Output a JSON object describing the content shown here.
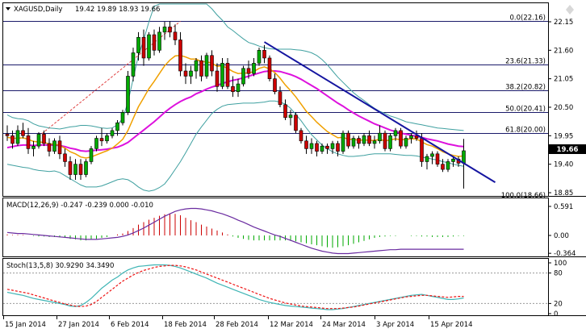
{
  "header": {
    "symbol": "XAGUSD,Daily",
    "ohlc": "19.42 19.89 18.93 19.66"
  },
  "main_panel": {
    "price_axis": [
      "22.15",
      "21.60",
      "21.05",
      "20.50",
      "19.95",
      "19.40",
      "18.85"
    ],
    "current_price": "19.66",
    "fib_levels": [
      {
        "label": "0.0(22.16)",
        "value": 22.16
      },
      {
        "label": "23.6(21.33)",
        "value": 21.33
      },
      {
        "label": "38.2(20.82)",
        "value": 20.82
      },
      {
        "label": "50.0(20.41)",
        "value": 20.41
      },
      {
        "label": "61.8(20.00)",
        "value": 20.0
      },
      {
        "label": "100.0(18.66)",
        "value": 18.66
      }
    ]
  },
  "macd_panel": {
    "title": "MACD(12,26,9) -0.247 -0.239 0.000 -0.010",
    "axis": [
      "0.591",
      "0.00",
      "-0.364"
    ]
  },
  "stoch_panel": {
    "title": "Stoch(13,5,8) 30.9290 34.3490",
    "axis": [
      "100",
      "80",
      "20",
      "0"
    ]
  },
  "time_axis": [
    "15 Jan 2014",
    "27 Jan 2014",
    "6 Feb 2014",
    "18 Feb 2014",
    "28 Feb 2014",
    "12 Mar 2014",
    "24 Mar 2014",
    "3 Apr 2014",
    "15 Apr 2014"
  ],
  "colors": {
    "bull": "#00aa00",
    "bear": "#cc0000",
    "trendline": "#1515a0",
    "ma_fast": "#f0a000",
    "ma_slow": "#dd11dd",
    "bollinger": "#3fa0a0",
    "macd_line": "#6a2ba0",
    "stoch_main": "#3fb5b5",
    "stoch_signal": "#ee1111"
  },
  "chart_data": {
    "type": "candlestick",
    "title": "XAGUSD,Daily",
    "ylim": [
      18.85,
      22.3
    ],
    "trendline": [
      {
        "bar": 49,
        "price": 21.76
      },
      {
        "bar": 87,
        "price": 19.42
      }
    ],
    "candles": [
      {
        "o": 19.98,
        "h": 20.15,
        "l": 19.85,
        "c": 19.95
      },
      {
        "o": 19.95,
        "h": 20.05,
        "l": 19.7,
        "c": 19.8
      },
      {
        "o": 19.8,
        "h": 20.15,
        "l": 19.75,
        "c": 20.05
      },
      {
        "o": 20.05,
        "h": 20.2,
        "l": 19.9,
        "c": 19.95
      },
      {
        "o": 19.95,
        "h": 20.1,
        "l": 19.6,
        "c": 19.7
      },
      {
        "o": 19.7,
        "h": 19.85,
        "l": 19.55,
        "c": 19.75
      },
      {
        "o": 19.75,
        "h": 20.02,
        "l": 19.7,
        "c": 19.98
      },
      {
        "o": 19.98,
        "h": 20.05,
        "l": 19.75,
        "c": 19.8
      },
      {
        "o": 19.8,
        "h": 19.9,
        "l": 19.55,
        "c": 19.65
      },
      {
        "o": 19.65,
        "h": 19.9,
        "l": 19.6,
        "c": 19.85
      },
      {
        "o": 19.85,
        "h": 19.95,
        "l": 19.5,
        "c": 19.6
      },
      {
        "o": 19.6,
        "h": 19.7,
        "l": 19.35,
        "c": 19.45
      },
      {
        "o": 19.45,
        "h": 19.55,
        "l": 19.1,
        "c": 19.2
      },
      {
        "o": 19.2,
        "h": 19.5,
        "l": 19.1,
        "c": 19.4
      },
      {
        "o": 19.4,
        "h": 19.5,
        "l": 19.1,
        "c": 19.2
      },
      {
        "o": 19.2,
        "h": 19.5,
        "l": 19.15,
        "c": 19.45
      },
      {
        "o": 19.45,
        "h": 19.75,
        "l": 19.4,
        "c": 19.7
      },
      {
        "o": 19.7,
        "h": 19.95,
        "l": 19.65,
        "c": 19.9
      },
      {
        "o": 19.9,
        "h": 20.1,
        "l": 19.75,
        "c": 19.85
      },
      {
        "o": 19.85,
        "h": 20.0,
        "l": 19.8,
        "c": 19.95
      },
      {
        "o": 19.95,
        "h": 20.1,
        "l": 19.9,
        "c": 20.05
      },
      {
        "o": 20.05,
        "h": 20.25,
        "l": 19.95,
        "c": 20.2
      },
      {
        "o": 20.2,
        "h": 20.45,
        "l": 20.15,
        "c": 20.4
      },
      {
        "o": 20.4,
        "h": 21.2,
        "l": 20.35,
        "c": 21.1
      },
      {
        "o": 21.1,
        "h": 21.65,
        "l": 21.0,
        "c": 21.55
      },
      {
        "o": 21.55,
        "h": 21.95,
        "l": 21.4,
        "c": 21.85
      },
      {
        "o": 21.85,
        "h": 22.0,
        "l": 21.3,
        "c": 21.45
      },
      {
        "o": 21.45,
        "h": 21.95,
        "l": 21.4,
        "c": 21.9
      },
      {
        "o": 21.9,
        "h": 22.0,
        "l": 21.5,
        "c": 21.6
      },
      {
        "o": 21.6,
        "h": 22.05,
        "l": 21.55,
        "c": 21.95
      },
      {
        "o": 21.95,
        "h": 22.15,
        "l": 21.8,
        "c": 22.05
      },
      {
        "o": 22.05,
        "h": 22.16,
        "l": 21.85,
        "c": 21.95
      },
      {
        "o": 21.95,
        "h": 22.1,
        "l": 21.7,
        "c": 21.8
      },
      {
        "o": 21.8,
        "h": 21.95,
        "l": 21.1,
        "c": 21.2
      },
      {
        "o": 21.2,
        "h": 21.35,
        "l": 20.95,
        "c": 21.1
      },
      {
        "o": 21.1,
        "h": 21.3,
        "l": 20.95,
        "c": 21.2
      },
      {
        "o": 21.2,
        "h": 21.45,
        "l": 21.05,
        "c": 21.4
      },
      {
        "o": 21.4,
        "h": 21.5,
        "l": 21.0,
        "c": 21.1
      },
      {
        "o": 21.1,
        "h": 21.55,
        "l": 21.05,
        "c": 21.5
      },
      {
        "o": 21.5,
        "h": 21.6,
        "l": 21.1,
        "c": 21.2
      },
      {
        "o": 21.2,
        "h": 21.35,
        "l": 20.8,
        "c": 20.9
      },
      {
        "o": 20.9,
        "h": 21.45,
        "l": 20.85,
        "c": 21.35
      },
      {
        "o": 21.35,
        "h": 21.45,
        "l": 20.85,
        "c": 20.9
      },
      {
        "o": 20.9,
        "h": 21.1,
        "l": 20.7,
        "c": 20.8
      },
      {
        "o": 20.8,
        "h": 21.05,
        "l": 20.7,
        "c": 20.95
      },
      {
        "o": 20.95,
        "h": 21.3,
        "l": 20.9,
        "c": 21.25
      },
      {
        "o": 21.25,
        "h": 21.4,
        "l": 21.05,
        "c": 21.15
      },
      {
        "o": 21.15,
        "h": 21.45,
        "l": 21.1,
        "c": 21.35
      },
      {
        "o": 21.35,
        "h": 21.65,
        "l": 21.3,
        "c": 21.6
      },
      {
        "o": 21.6,
        "h": 21.7,
        "l": 21.35,
        "c": 21.45
      },
      {
        "o": 21.45,
        "h": 21.5,
        "l": 21.0,
        "c": 21.05
      },
      {
        "o": 21.05,
        "h": 21.15,
        "l": 20.75,
        "c": 20.8
      },
      {
        "o": 20.8,
        "h": 20.9,
        "l": 20.5,
        "c": 20.55
      },
      {
        "o": 20.55,
        "h": 20.65,
        "l": 20.25,
        "c": 20.3
      },
      {
        "o": 20.3,
        "h": 20.45,
        "l": 20.15,
        "c": 20.35
      },
      {
        "o": 20.35,
        "h": 20.4,
        "l": 20.0,
        "c": 20.05
      },
      {
        "o": 20.05,
        "h": 20.1,
        "l": 19.8,
        "c": 19.85
      },
      {
        "o": 19.85,
        "h": 19.95,
        "l": 19.6,
        "c": 19.7
      },
      {
        "o": 19.7,
        "h": 19.9,
        "l": 19.6,
        "c": 19.8
      },
      {
        "o": 19.8,
        "h": 19.85,
        "l": 19.55,
        "c": 19.65
      },
      {
        "o": 19.65,
        "h": 19.8,
        "l": 19.6,
        "c": 19.75
      },
      {
        "o": 19.75,
        "h": 19.8,
        "l": 19.6,
        "c": 19.7
      },
      {
        "o": 19.7,
        "h": 19.85,
        "l": 19.6,
        "c": 19.8
      },
      {
        "o": 19.8,
        "h": 19.85,
        "l": 19.55,
        "c": 19.65
      },
      {
        "o": 19.65,
        "h": 20.05,
        "l": 19.6,
        "c": 20.0
      },
      {
        "o": 20.0,
        "h": 20.05,
        "l": 19.7,
        "c": 19.75
      },
      {
        "o": 19.75,
        "h": 19.95,
        "l": 19.7,
        "c": 19.9
      },
      {
        "o": 19.9,
        "h": 19.95,
        "l": 19.7,
        "c": 19.8
      },
      {
        "o": 19.8,
        "h": 20.0,
        "l": 19.75,
        "c": 19.95
      },
      {
        "o": 19.95,
        "h": 20.05,
        "l": 19.75,
        "c": 19.8
      },
      {
        "o": 19.8,
        "h": 19.95,
        "l": 19.7,
        "c": 19.85
      },
      {
        "o": 19.85,
        "h": 20.15,
        "l": 19.8,
        "c": 20.0
      },
      {
        "o": 20.0,
        "h": 20.05,
        "l": 19.65,
        "c": 19.7
      },
      {
        "o": 19.7,
        "h": 20.0,
        "l": 19.65,
        "c": 19.95
      },
      {
        "o": 19.95,
        "h": 20.1,
        "l": 19.85,
        "c": 20.05
      },
      {
        "o": 20.05,
        "h": 20.1,
        "l": 19.7,
        "c": 19.75
      },
      {
        "o": 19.75,
        "h": 19.95,
        "l": 19.7,
        "c": 19.9
      },
      {
        "o": 19.9,
        "h": 20.0,
        "l": 19.8,
        "c": 19.95
      },
      {
        "o": 19.95,
        "h": 20.05,
        "l": 19.85,
        "c": 19.9
      },
      {
        "o": 19.9,
        "h": 20.0,
        "l": 19.35,
        "c": 19.45
      },
      {
        "o": 19.45,
        "h": 19.6,
        "l": 19.3,
        "c": 19.55
      },
      {
        "o": 19.55,
        "h": 19.65,
        "l": 19.4,
        "c": 19.6
      },
      {
        "o": 19.6,
        "h": 19.65,
        "l": 19.35,
        "c": 19.4
      },
      {
        "o": 19.4,
        "h": 19.5,
        "l": 19.25,
        "c": 19.3
      },
      {
        "o": 19.3,
        "h": 19.5,
        "l": 19.25,
        "c": 19.45
      },
      {
        "o": 19.45,
        "h": 19.55,
        "l": 19.35,
        "c": 19.5
      },
      {
        "o": 19.5,
        "h": 19.55,
        "l": 19.35,
        "c": 19.42
      },
      {
        "o": 19.42,
        "h": 19.89,
        "l": 18.93,
        "c": 19.66
      }
    ],
    "ma_fast": [
      19.92,
      19.9,
      19.9,
      19.91,
      19.88,
      19.84,
      19.83,
      19.82,
      19.79,
      19.79,
      19.76,
      19.71,
      19.64,
      19.6,
      19.54,
      19.52,
      19.54,
      19.58,
      19.62,
      19.66,
      19.71,
      19.79,
      19.88,
      20.05,
      20.28,
      20.51,
      20.68,
      20.86,
      21.0,
      21.15,
      21.3,
      21.41,
      21.49,
      21.5,
      21.47,
      21.43,
      21.43,
      21.38,
      21.38,
      21.35,
      21.29,
      21.3,
      21.25,
      21.19,
      21.15,
      21.16,
      21.16,
      21.19,
      21.25,
      21.28,
      21.24,
      21.17,
      21.06,
      20.93,
      20.82,
      20.7,
      20.56,
      20.42,
      20.32,
      20.21,
      20.12,
      20.03,
      19.97,
      19.91,
      19.92,
      19.88,
      19.88,
      19.86,
      19.87,
      19.86,
      19.86,
      19.88,
      19.85,
      19.87,
      19.89,
      19.87,
      19.88,
      19.89,
      19.89,
      19.83,
      19.78,
      19.75,
      19.7,
      19.64,
      19.6,
      19.57,
      19.55,
      19.56
    ],
    "ma_slow": [
      19.72,
      19.74,
      19.76,
      19.77,
      19.77,
      19.76,
      19.77,
      19.77,
      19.77,
      19.77,
      19.76,
      19.74,
      19.71,
      19.69,
      19.66,
      19.65,
      19.66,
      19.67,
      19.68,
      19.69,
      19.71,
      19.73,
      19.77,
      19.82,
      19.9,
      19.98,
      20.06,
      20.14,
      20.22,
      20.31,
      20.4,
      20.48,
      20.55,
      20.61,
      20.66,
      20.7,
      20.76,
      20.8,
      20.85,
      20.89,
      20.92,
      20.96,
      20.99,
      21.02,
      21.04,
      21.07,
      21.1,
      21.13,
      21.16,
      21.19,
      21.2,
      21.2,
      21.19,
      21.16,
      21.13,
      21.09,
      21.04,
      20.98,
      20.92,
      20.86,
      20.79,
      20.72,
      20.65,
      20.58,
      20.52,
      20.45,
      20.39,
      20.33,
      20.28,
      20.23,
      20.18,
      20.14,
      20.1,
      20.06,
      20.03,
      20.0,
      19.98,
      19.96,
      19.94,
      19.92,
      19.89,
      19.87,
      19.85,
      19.82,
      19.79,
      19.77,
      19.75,
      19.74
    ],
    "bb_upper": [
      20.35,
      20.3,
      20.28,
      20.27,
      20.24,
      20.18,
      20.14,
      20.12,
      20.1,
      20.09,
      20.08,
      20.1,
      20.12,
      20.13,
      20.15,
      20.15,
      20.14,
      20.12,
      20.1,
      20.09,
      20.1,
      20.16,
      20.28,
      20.6,
      21.05,
      21.5,
      21.8,
      22.15,
      22.45,
      22.7,
      22.93,
      23.1,
      23.2,
      23.2,
      23.12,
      23.0,
      22.88,
      22.72,
      22.55,
      22.4,
      22.28,
      22.18,
      22.05,
      21.98,
      21.9,
      21.82,
      21.75,
      21.72,
      21.68,
      21.65,
      21.63,
      21.62,
      21.62,
      21.62,
      21.62,
      21.61,
      21.6,
      21.58,
      21.55,
      21.5,
      21.42,
      21.32,
      21.2,
      21.08,
      20.98,
      20.88,
      20.78,
      20.7,
      20.63,
      20.55,
      20.48,
      20.42,
      20.38,
      20.33,
      20.3,
      20.26,
      20.22,
      20.2,
      20.18,
      20.16,
      20.14,
      20.12,
      20.1,
      20.09,
      20.08,
      20.07,
      20.06,
      20.05
    ],
    "bb_lower": [
      19.4,
      19.38,
      19.36,
      19.34,
      19.33,
      19.3,
      19.28,
      19.27,
      19.26,
      19.27,
      19.24,
      19.18,
      19.12,
      19.06,
      19.0,
      18.96,
      18.96,
      18.96,
      18.98,
      19.02,
      19.06,
      19.1,
      19.12,
      19.1,
      19.04,
      18.96,
      18.9,
      18.88,
      18.9,
      18.95,
      19.02,
      19.15,
      19.3,
      19.45,
      19.62,
      19.8,
      19.98,
      20.12,
      20.25,
      20.38,
      20.46,
      20.52,
      20.55,
      20.56,
      20.57,
      20.58,
      20.58,
      20.58,
      20.59,
      20.6,
      20.62,
      20.62,
      20.6,
      20.56,
      20.48,
      20.36,
      20.24,
      20.1,
      19.97,
      19.87,
      19.77,
      19.7,
      19.64,
      19.6,
      19.57,
      19.55,
      19.55,
      19.56,
      19.57,
      19.59,
      19.6,
      19.6,
      19.6,
      19.6,
      19.59,
      19.58,
      19.57,
      19.57,
      19.56,
      19.54,
      19.52,
      19.5,
      19.48,
      19.45,
      19.43,
      19.4,
      19.38,
      19.36
    ],
    "macd": {
      "ylim": [
        -0.45,
        0.62
      ],
      "histogram": [
        0.02,
        0.01,
        0.01,
        0.01,
        0.0,
        -0.01,
        -0.02,
        -0.02,
        -0.03,
        -0.03,
        -0.04,
        -0.05,
        -0.07,
        -0.08,
        -0.1,
        -0.1,
        -0.09,
        -0.07,
        -0.05,
        -0.03,
        0.0,
        0.02,
        0.04,
        0.09,
        0.15,
        0.22,
        0.27,
        0.32,
        0.36,
        0.4,
        0.43,
        0.45,
        0.44,
        0.41,
        0.36,
        0.31,
        0.27,
        0.22,
        0.18,
        0.14,
        0.1,
        0.06,
        0.02,
        -0.02,
        -0.05,
        -0.07,
        -0.09,
        -0.1,
        -0.1,
        -0.1,
        -0.1,
        -0.1,
        -0.1,
        -0.1,
        -0.11,
        -0.12,
        -0.14,
        -0.16,
        -0.18,
        -0.2,
        -0.22,
        -0.24,
        -0.25,
        -0.24,
        -0.22,
        -0.2,
        -0.17,
        -0.14,
        -0.11,
        -0.08,
        -0.05,
        -0.03,
        -0.02,
        -0.01,
        -0.01,
        0.0,
        0.0,
        -0.01,
        -0.01,
        -0.02,
        -0.02,
        -0.03,
        -0.03,
        -0.03,
        -0.03,
        -0.02,
        -0.01,
        -0.01
      ],
      "signal": [
        0.06,
        0.05,
        0.04,
        0.04,
        0.03,
        0.02,
        0.01,
        0.0,
        -0.01,
        -0.02,
        -0.03,
        -0.04,
        -0.05,
        -0.06,
        -0.07,
        -0.08,
        -0.08,
        -0.08,
        -0.07,
        -0.06,
        -0.05,
        -0.04,
        -0.02,
        0.01,
        0.05,
        0.1,
        0.15,
        0.21,
        0.27,
        0.33,
        0.39,
        0.44,
        0.49,
        0.52,
        0.54,
        0.55,
        0.55,
        0.54,
        0.52,
        0.5,
        0.47,
        0.44,
        0.4,
        0.36,
        0.31,
        0.27,
        0.22,
        0.17,
        0.13,
        0.09,
        0.05,
        0.01,
        -0.02,
        -0.06,
        -0.1,
        -0.14,
        -0.18,
        -0.22,
        -0.26,
        -0.29,
        -0.32,
        -0.34,
        -0.36,
        -0.37,
        -0.37,
        -0.37,
        -0.36,
        -0.35,
        -0.34,
        -0.33,
        -0.32,
        -0.31,
        -0.3,
        -0.29,
        -0.29,
        -0.28,
        -0.28,
        -0.28,
        -0.28,
        -0.28,
        -0.28,
        -0.28,
        -0.28,
        -0.28,
        -0.28,
        -0.28,
        -0.28,
        -0.28
      ]
    },
    "stoch": {
      "ylim": [
        0,
        100
      ],
      "main": [
        42,
        40,
        38,
        36,
        33,
        30,
        28,
        26,
        24,
        22,
        20,
        18,
        15,
        14,
        16,
        22,
        30,
        40,
        50,
        58,
        66,
        72,
        80,
        86,
        90,
        93,
        94,
        95,
        96,
        96,
        96,
        95,
        93,
        90,
        86,
        82,
        78,
        74,
        70,
        65,
        60,
        56,
        52,
        48,
        44,
        40,
        36,
        32,
        28,
        25,
        22,
        20,
        18,
        16,
        15,
        14,
        13,
        12,
        11,
        10,
        9,
        8,
        8,
        9,
        10,
        12,
        14,
        16,
        18,
        20,
        22,
        24,
        26,
        28,
        30,
        32,
        34,
        36,
        37,
        38,
        36,
        34,
        32,
        30,
        28,
        28,
        29,
        31
      ],
      "signal": [
        48,
        46,
        44,
        42,
        40,
        37,
        34,
        31,
        28,
        25,
        22,
        19,
        17,
        15,
        14,
        15,
        18,
        24,
        32,
        40,
        48,
        56,
        64,
        70,
        76,
        81,
        85,
        88,
        91,
        93,
        94,
        95,
        95,
        94,
        92,
        89,
        86,
        82,
        78,
        74,
        70,
        66,
        62,
        58,
        54,
        50,
        46,
        42,
        38,
        34,
        30,
        27,
        24,
        21,
        19,
        17,
        15,
        14,
        13,
        12,
        11,
        10,
        10,
        10,
        11,
        12,
        13,
        15,
        17,
        19,
        21,
        23,
        25,
        27,
        29,
        31,
        33,
        34,
        35,
        36,
        36,
        35,
        34,
        33,
        32,
        33,
        34,
        34
      ]
    }
  }
}
